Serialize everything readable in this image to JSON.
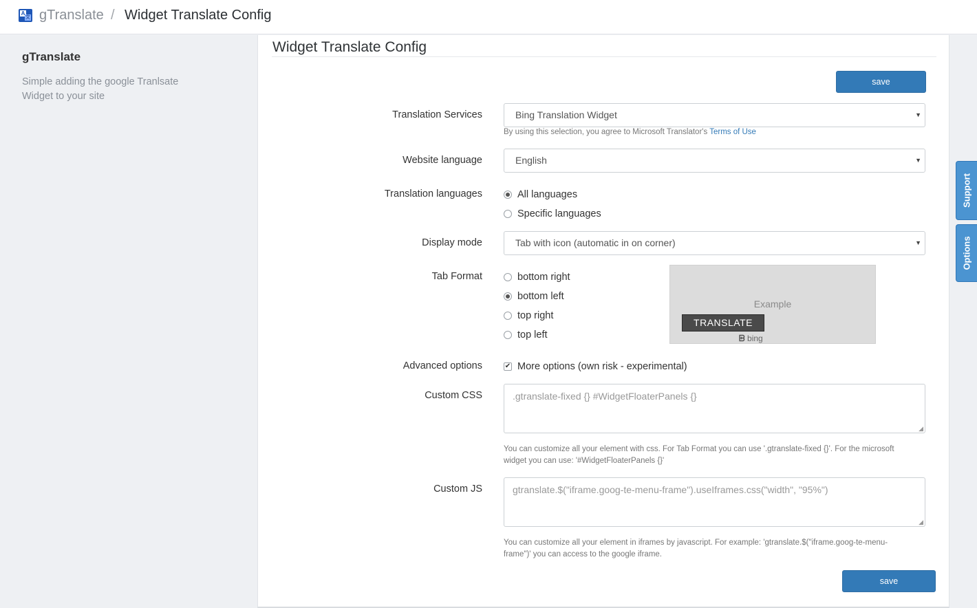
{
  "header": {
    "app_name": "gTranslate",
    "separator": "/",
    "page_title": "Widget Translate Config",
    "app_icon": "translate-app-icon"
  },
  "sidebar": {
    "title": "gTranslate",
    "description": "Simple adding the google Tranlsate Widget to your site"
  },
  "panel": {
    "title": "Widget Translate Config",
    "save_label": "save"
  },
  "form": {
    "translation_services": {
      "label": "Translation Services",
      "value": "Bing Translation Widget",
      "help_prefix": "By using this selection, you agree to Microsoft Translator's ",
      "help_link": "Terms of Use"
    },
    "website_language": {
      "label": "Website language",
      "value": "English"
    },
    "translation_languages": {
      "label": "Translation languages",
      "options": [
        "All languages",
        "Specific languages"
      ],
      "selected": "All languages"
    },
    "display_mode": {
      "label": "Display mode",
      "value": "Tab with icon (automatic in on corner)"
    },
    "tab_format": {
      "label": "Tab Format",
      "options": [
        "bottom right",
        "bottom left",
        "top right",
        "top left"
      ],
      "selected": "bottom left",
      "example": {
        "label": "Example",
        "button_text": "TRANSLATE",
        "brand": "bing"
      }
    },
    "advanced_options": {
      "label": "Advanced options",
      "checkbox_label": "More options (own risk - experimental)",
      "checked": true
    },
    "custom_css": {
      "label": "Custom CSS",
      "placeholder": ".gtranslate-fixed {} #WidgetFloaterPanels {}",
      "help_line1": "You can customize all your element with css. For Tab Format you can use '.gtranslate-fixed {}'. For the microsoft",
      "help_line2": "widget you can use: '#WidgetFloaterPanels {}'"
    },
    "custom_js": {
      "label": "Custom JS",
      "placeholder": "gtranslate.$(\"iframe.goog-te-menu-frame\").useIframes.css(\"width\", \"95%\")",
      "help_line1": "You can customize all your element in iframes by javascript. For example: 'gtranslate.$(\"iframe.goog-te-menu-",
      "help_line2": "frame\")' you can access to the google iframe."
    }
  },
  "side_tabs": {
    "support": "Support",
    "options": "Options"
  },
  "colors": {
    "primary": "#337ab7",
    "side_tab": "#4b94d1",
    "background": "#eef0f3"
  }
}
